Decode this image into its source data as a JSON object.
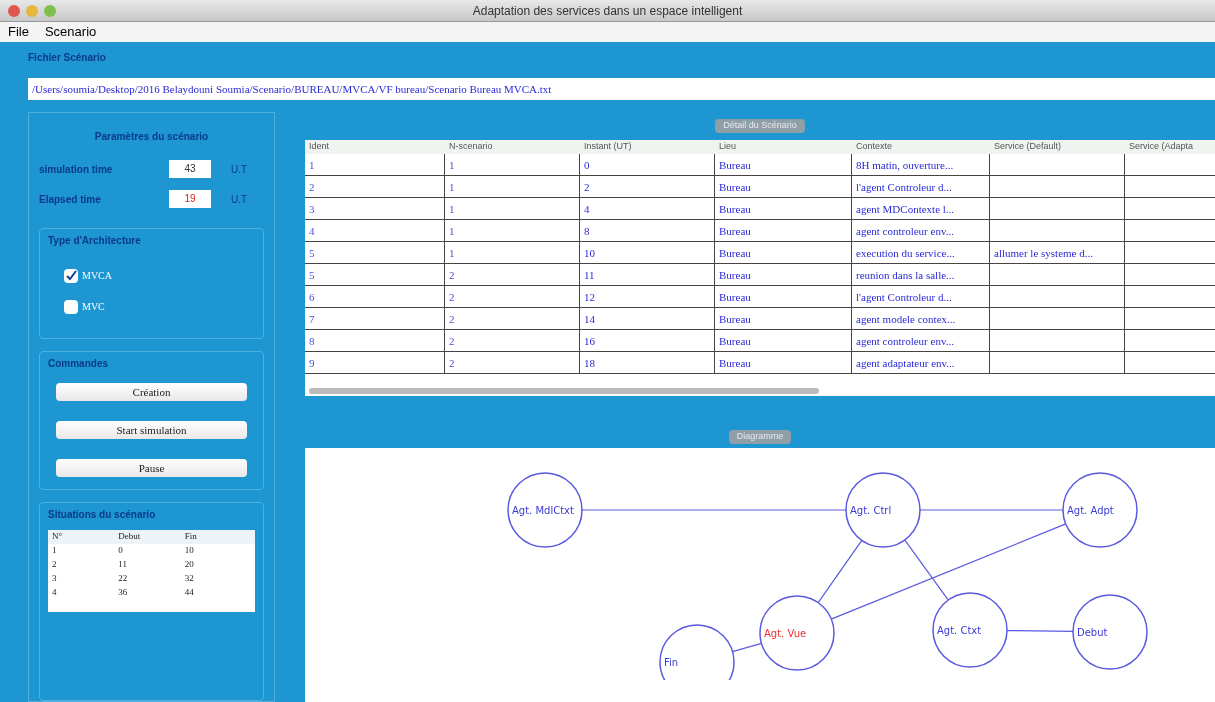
{
  "window": {
    "title": "Adaptation des services dans un espace intelligent"
  },
  "menu": [
    "File",
    "Scenario"
  ],
  "file": {
    "label": "Fichier Scénario",
    "path": "/Users/soumia/Desktop/2016 Belaydouni Soumia/Scenario/BUREAU/MVCA/VF bureau/Scenario Bureau MVCA.txt"
  },
  "parameters": {
    "title": "Paramètres du scénario",
    "fields": [
      {
        "label": "simulation time",
        "value": "43",
        "unit": "U.T",
        "alert": false
      },
      {
        "label": "Elapsed time",
        "value": "19",
        "unit": "U.T",
        "alert": true
      }
    ]
  },
  "architecture": {
    "title": "Type d'Architecture",
    "options": [
      {
        "label": "MVCA",
        "checked": true
      },
      {
        "label": "MVC",
        "checked": false
      }
    ]
  },
  "commands": {
    "title": "Commandes",
    "buttons": [
      "Création",
      "Start simulation",
      "Pause"
    ]
  },
  "situations": {
    "title": "Situations du scénario",
    "columns": [
      "N°",
      "Debut",
      "Fin"
    ],
    "rows": [
      [
        "1",
        "0",
        "10"
      ],
      [
        "2",
        "11",
        "20"
      ],
      [
        "3",
        "22",
        "32"
      ],
      [
        "4",
        "36",
        "44"
      ]
    ]
  },
  "detail": {
    "button": "Détail du Scénario",
    "columns": [
      "Ident",
      "N-scenario",
      "Instant (UT)",
      "Lieu",
      "Contexte",
      "Service (Default)",
      "Service (Adapta"
    ],
    "rows": [
      [
        "1",
        "1",
        "0",
        "Bureau",
        "8H matin, ouverture...",
        ""
      ],
      [
        "2",
        "1",
        "2",
        "Bureau",
        "l'agent Controleur d...",
        ""
      ],
      [
        "3",
        "1",
        "4",
        "Bureau",
        "agent MDContexte l...",
        ""
      ],
      [
        "4",
        "1",
        "8",
        "Bureau",
        "agent controleur env...",
        ""
      ],
      [
        "5",
        "1",
        "10",
        "Bureau",
        "execution du service...",
        "allumer le systeme d..."
      ],
      [
        "5",
        "2",
        "11",
        "Bureau",
        "reunion dans la salle...",
        ""
      ],
      [
        "6",
        "2",
        "12",
        "Bureau",
        "l'agent Controleur d...",
        ""
      ],
      [
        "7",
        "2",
        "14",
        "Bureau",
        "agent modele contex...",
        ""
      ],
      [
        "8",
        "2",
        "16",
        "Bureau",
        "agent controleur env...",
        ""
      ],
      [
        "9",
        "2",
        "18",
        "Bureau",
        "agent adaptateur env...",
        ""
      ]
    ]
  },
  "diagram": {
    "button": "Diagramme",
    "nodes": [
      {
        "label": "Agt. MdlCtxt",
        "active": false
      },
      {
        "label": "Agt. Ctrl",
        "active": false
      },
      {
        "label": "Agt. Adpt",
        "active": false
      },
      {
        "label": "Agt. Vue",
        "active": true
      },
      {
        "label": "Agt. Ctxt",
        "active": false
      },
      {
        "label": "Debut",
        "active": false
      },
      {
        "label": "Fin",
        "active": false
      }
    ]
  }
}
